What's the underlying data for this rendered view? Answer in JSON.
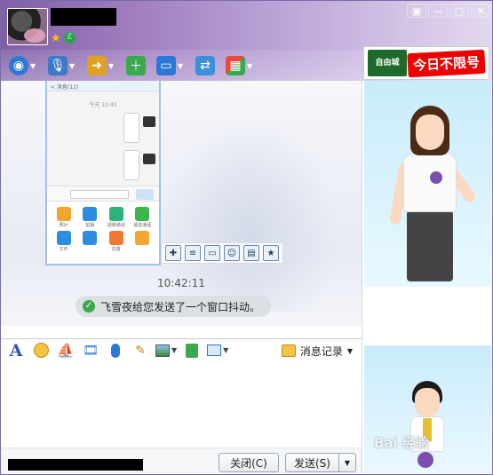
{
  "header": {
    "contact_name": "",
    "window_buttons": {
      "menu": "▣",
      "minimize": "—",
      "maximize": "□",
      "close": "✕"
    }
  },
  "toolbar": {
    "items": [
      {
        "icon": "video-call-icon",
        "glyph": "◉",
        "color": "#2a79d6"
      },
      {
        "icon": "voice-call-icon",
        "glyph": "🎙",
        "color": "#3f78c8"
      },
      {
        "icon": "file-transfer-icon",
        "glyph": "📁",
        "color": "#e0a122"
      },
      {
        "icon": "create-group-icon",
        "glyph": "＋",
        "color": "#3aa84c"
      },
      {
        "icon": "remote-desktop-icon",
        "glyph": "🖥",
        "color": "#2a79d6"
      },
      {
        "icon": "share-screen-icon",
        "glyph": "⇄",
        "color": "#3d8fd8"
      },
      {
        "icon": "app-center-icon",
        "glyph": "▦",
        "color": "#e84a3a"
      }
    ]
  },
  "ad": {
    "banner_text": "今日不限号",
    "logo_text": "自由城"
  },
  "messages": {
    "time": "10:42:11",
    "shake_notice": "飞雪夜给您发送了一个窗口抖动。"
  },
  "phone_screenshot": {
    "top_label": "< 消息(12)",
    "chat_time": "今天 10:40",
    "apps": [
      {
        "label": "照片",
        "color": "#f2a531"
      },
      {
        "label": "拍摄",
        "color": "#2b8ce0"
      },
      {
        "label": "视频通话",
        "color": "#2ab37a"
      },
      {
        "label": "语音通话",
        "color": "#3cb54a"
      },
      {
        "label": "文件",
        "color": "#2b8ce0"
      },
      {
        "label": "",
        "color": "#2b8ce0"
      },
      {
        "label": "位置",
        "color": "#f07a2e"
      },
      {
        "label": "",
        "color": "#f2a531"
      }
    ]
  },
  "float_toolbar": [
    "pin-icon",
    "document-icon",
    "monitor-icon",
    "emoji-icon",
    "image-icon",
    "star-icon"
  ],
  "input_toolbar": {
    "font": "A",
    "items": [
      "emoji-icon",
      "sail-icon",
      "film-icon",
      "mic-icon",
      "note-icon",
      "image-icon",
      "gift-icon",
      "screen-icon"
    ],
    "history_label": "消息记录"
  },
  "input": {
    "value": "",
    "placeholder": ""
  },
  "buttons": {
    "close": "关闭(C)",
    "send": "发送(S)",
    "send_dropdown": "▼"
  },
  "watermark": "Bai 经验"
}
